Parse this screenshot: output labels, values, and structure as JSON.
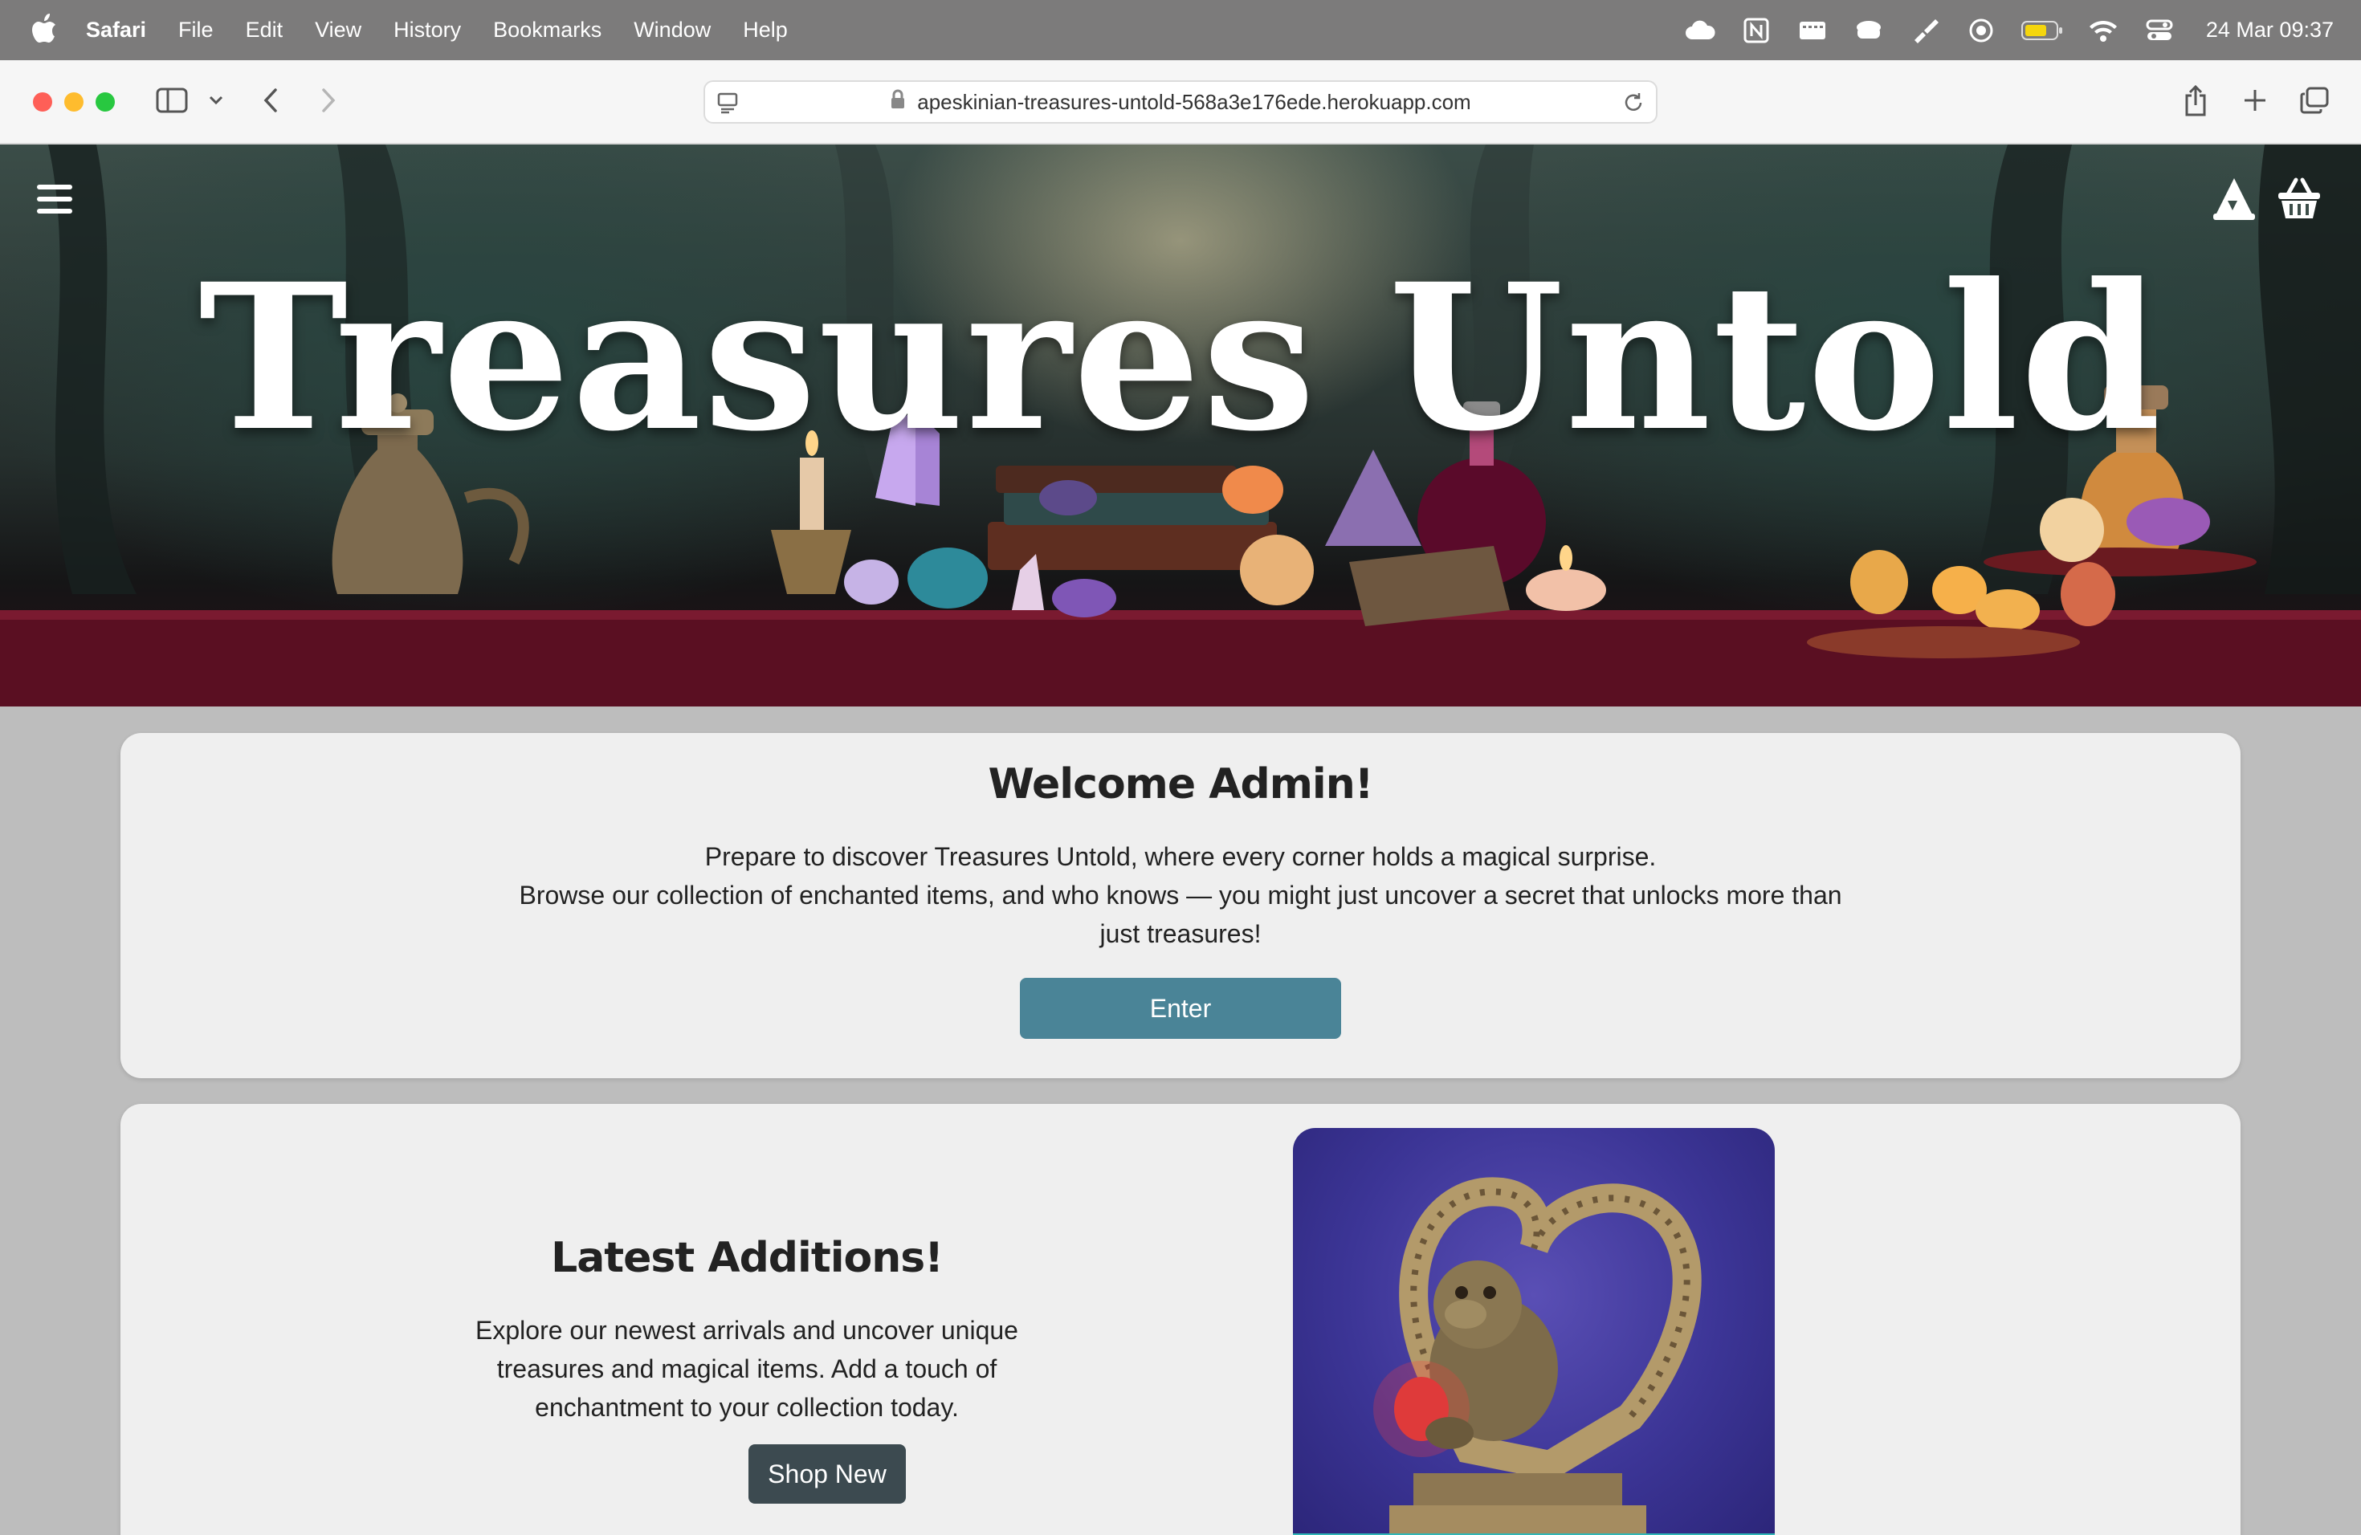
{
  "menubar": {
    "app_name": "Safari",
    "items": [
      "File",
      "Edit",
      "View",
      "History",
      "Bookmarks",
      "Window",
      "Help"
    ],
    "clock": "24 Mar  09:37",
    "status_icons": [
      "cloud-icon",
      "notion-icon",
      "keyboard-icon",
      "cup-icon",
      "brush-icon",
      "record-icon",
      "battery-icon",
      "wifi-icon",
      "control-center-icon"
    ]
  },
  "browser": {
    "url": "apeskinian-treasures-untold-568a3e176ede.herokuapp.com"
  },
  "hero": {
    "title": "Treasures Untold"
  },
  "welcome": {
    "heading": "Welcome Admin!",
    "line1": "Prepare to discover Treasures Untold, where every corner holds a magical surprise.",
    "line2": "Browse our collection of enchanted items, and who knows — you might just uncover a secret that unlocks more than just treasures!",
    "button": "Enter"
  },
  "latest": {
    "heading": "Latest Additions!",
    "text": "Explore our newest arrivals and uncover unique treasures and magical items. Add a touch of enchantment to your collection today.",
    "button": "Shop New"
  },
  "colors": {
    "enter_button": "#4a8497",
    "shop_button": "#3c4a50",
    "card_bg": "#efefef",
    "page_bg": "#bdbdbd"
  }
}
